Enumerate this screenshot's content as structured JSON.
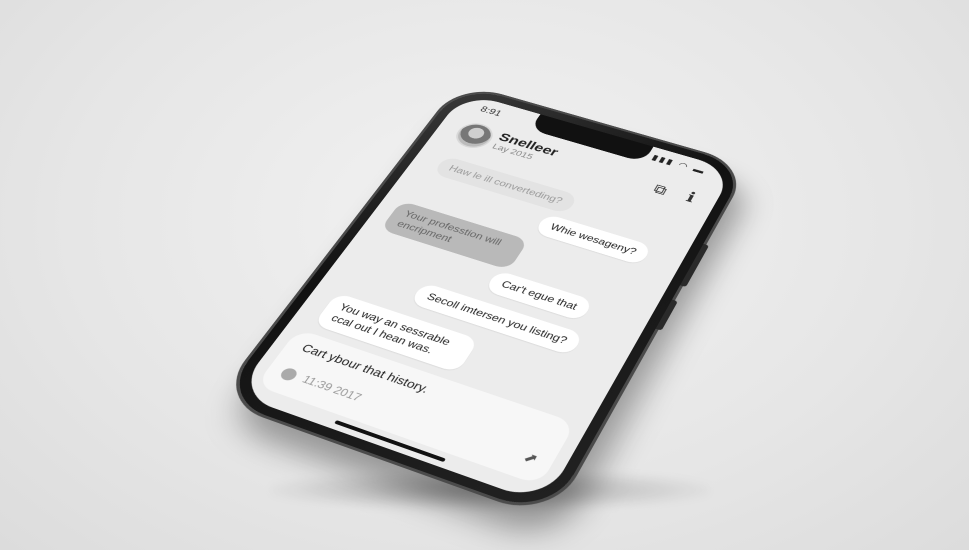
{
  "status_bar": {
    "time": "8:91",
    "icons": "▮▮▮ ◠ ▬"
  },
  "header": {
    "contact_name": "Snelleer",
    "contact_subtitle": "Lay 2015",
    "video_icon": "video-icon",
    "info_icon": "info-icon"
  },
  "messages": [
    {
      "text": "Haw le ill converteding?",
      "type": "in"
    },
    {
      "text": "Whie wesageny?",
      "type": "out"
    },
    {
      "text": "Your professtion will encripment",
      "type": "grey"
    },
    {
      "text": "Car't egue that",
      "type": "out"
    },
    {
      "text": "Secoll imtersen you listing?",
      "type": "out"
    },
    {
      "text": "You way an sessrable ccal out I hean was.",
      "type": "out"
    }
  ],
  "composer": {
    "text": "Cart ybour that history.",
    "date": "11:39 2017"
  }
}
